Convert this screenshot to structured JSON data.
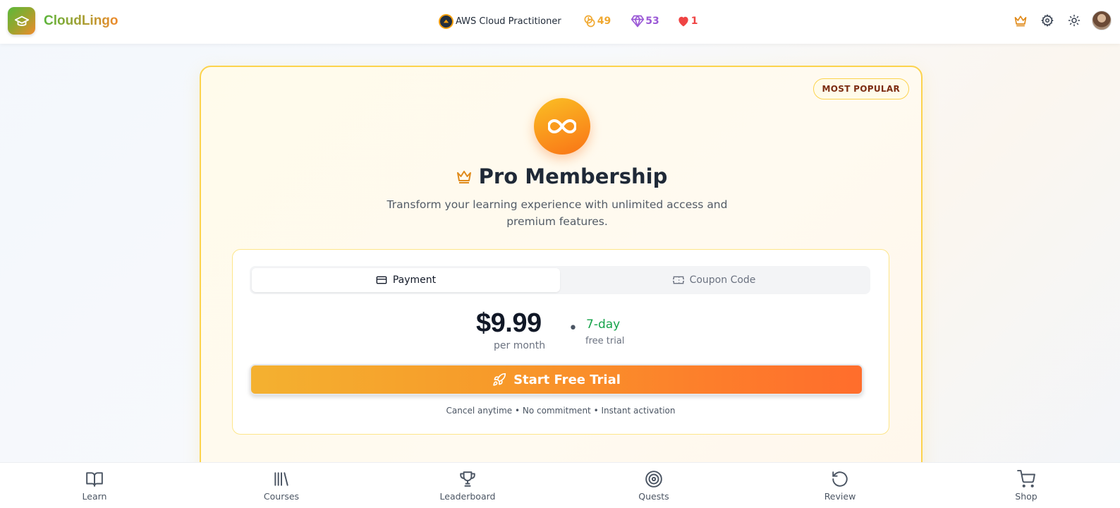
{
  "header": {
    "brand_name": "CloudLingo",
    "course_name": "AWS Cloud Practitioner",
    "streak_count": "49",
    "gems_count": "53",
    "hearts_count": "1"
  },
  "card": {
    "badge": "MOST POPULAR",
    "title": "Pro Membership",
    "description": "Transform your learning experience with unlimited access and premium features.",
    "tabs": [
      {
        "label": "Payment",
        "active": true
      },
      {
        "label": "Coupon Code",
        "active": false
      }
    ],
    "price": "$9.99",
    "price_period": "per month",
    "separator": "•",
    "trial_days": "7-day",
    "trial_label": "free trial",
    "cta_label": "Start Free Trial",
    "fine_print": "Cancel anytime • No commitment • Instant activation"
  },
  "bottom_nav": {
    "items": [
      {
        "label": "Learn",
        "icon": "book-icon"
      },
      {
        "label": "Courses",
        "icon": "library-icon"
      },
      {
        "label": "Leaderboard",
        "icon": "trophy-icon"
      },
      {
        "label": "Quests",
        "icon": "target-icon"
      },
      {
        "label": "Review",
        "icon": "rotate-ccw-icon"
      },
      {
        "label": "Shop",
        "icon": "cart-icon"
      }
    ]
  },
  "colors": {
    "brand_green": "#5bb43a",
    "brand_orange": "#f08a2c",
    "accent_orange": "#f97316",
    "card_border": "#fcd34d",
    "trial_green": "#16a34a",
    "gem_purple": "#9b59d6",
    "heart_red": "#ef4444"
  }
}
